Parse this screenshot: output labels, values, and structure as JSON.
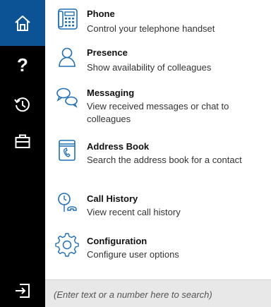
{
  "sidebar": {
    "items": [
      {
        "icon": "home-icon",
        "active": true
      },
      {
        "icon": "help-icon",
        "glyph": "?"
      },
      {
        "icon": "history-icon"
      },
      {
        "icon": "briefcase-icon"
      },
      {
        "icon": "sign-in-icon"
      }
    ],
    "active_color": "#0b5394"
  },
  "menu": {
    "items": [
      {
        "icon": "phone-icon",
        "title": "Phone",
        "description": "Control your telephone handset"
      },
      {
        "icon": "presence-icon",
        "title": "Presence",
        "description": "Show availability of colleagues"
      },
      {
        "icon": "messaging-icon",
        "title": "Messaging",
        "description": "View received messages or chat to colleagues"
      },
      {
        "icon": "address-book-icon",
        "title": "Address Book",
        "description": "Search the address book for a contact"
      },
      {
        "icon": "call-history-icon",
        "title": "Call History",
        "description": "View recent call history"
      },
      {
        "icon": "configuration-icon",
        "title": "Configuration",
        "description": "Configure user options"
      }
    ],
    "icon_color": "#1e6fb8"
  },
  "search": {
    "placeholder": "(Enter text or a number here to search)",
    "value": ""
  }
}
